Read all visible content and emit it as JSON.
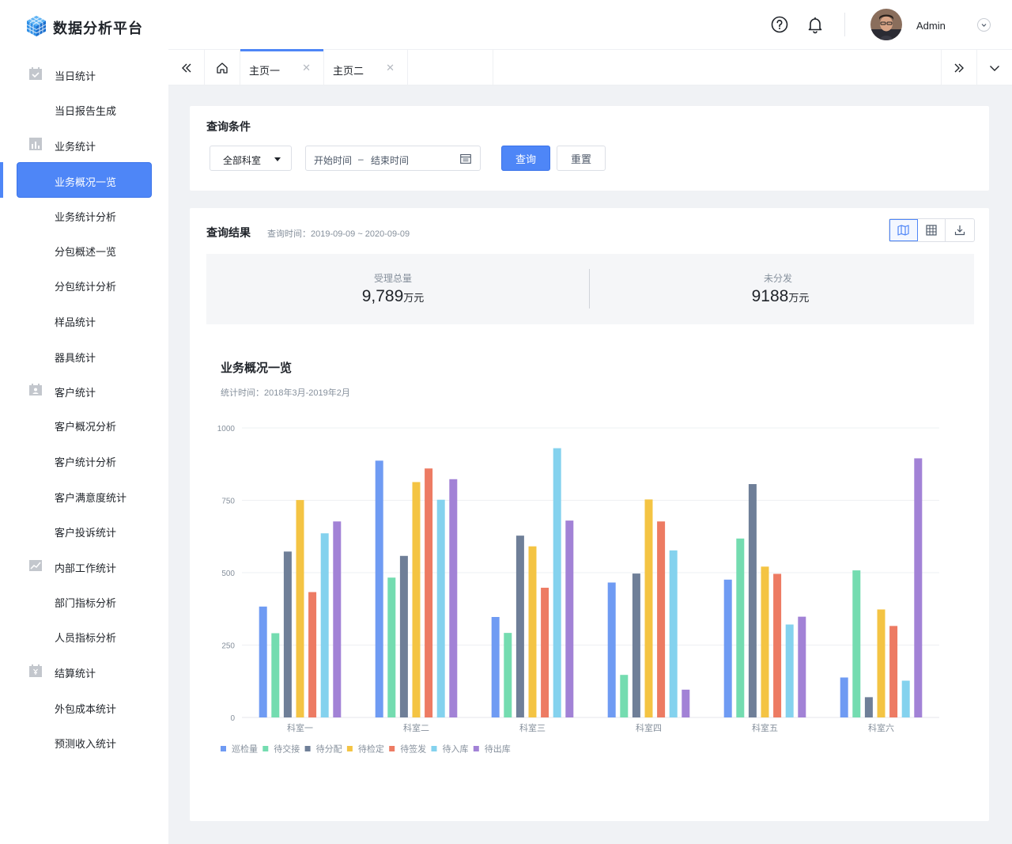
{
  "app": {
    "title": "数据分析平台"
  },
  "header": {
    "user_name": "Admin",
    "icons": [
      "help-icon",
      "bell-icon"
    ]
  },
  "sidebar": {
    "items": [
      {
        "label": "当日统计",
        "icon": "calendar-check-icon",
        "group": true
      },
      {
        "label": "当日报告生成"
      },
      {
        "label": "业务统计",
        "icon": "bar-chart-icon",
        "group": true
      },
      {
        "label": "业务概况一览",
        "active": true
      },
      {
        "label": "业务统计分析"
      },
      {
        "label": "分包概述一览"
      },
      {
        "label": "分包统计分析"
      },
      {
        "label": "样品统计"
      },
      {
        "label": "器具统计"
      },
      {
        "label": "客户统计",
        "icon": "contact-card-icon",
        "group": true
      },
      {
        "label": "客户概况分析"
      },
      {
        "label": "客户统计分析"
      },
      {
        "label": "客户满意度统计"
      },
      {
        "label": "客户投诉统计"
      },
      {
        "label": "内部工作统计",
        "icon": "trend-line-icon",
        "group": true
      },
      {
        "label": "部门指标分析"
      },
      {
        "label": "人员指标分析"
      },
      {
        "label": "结算统计",
        "icon": "yen-calendar-icon",
        "group": true
      },
      {
        "label": "外包成本统计"
      },
      {
        "label": "预测收入统计"
      }
    ]
  },
  "tabs": [
    {
      "label": "主页一",
      "active": true
    },
    {
      "label": "主页二",
      "active": false
    }
  ],
  "query": {
    "title": "查询条件",
    "department_value": "全部科室",
    "start_placeholder": "开始时间",
    "date_separator": "–",
    "end_placeholder": "结束时间",
    "search_label": "查询",
    "reset_label": "重置"
  },
  "result": {
    "title": "查询结果",
    "query_time": "查询时间：2019-09-09 ~ 2020-09-09",
    "summary": [
      {
        "label": "受理总量",
        "value": "9,789",
        "unit": "万元"
      },
      {
        "label": "未分发",
        "value": "9188",
        "unit": "万元"
      }
    ]
  },
  "chart_title": "业务概况一览",
  "chart_subtitle": "统计时间：2018年3月-2019年2月",
  "chart_data": {
    "type": "bar",
    "categories": [
      "科室一",
      "科室二",
      "科室三",
      "科室四",
      "科室五",
      "科室六"
    ],
    "ylim": [
      0,
      1000
    ],
    "yticks": [
      0,
      250,
      500,
      750,
      1000
    ],
    "grid": true,
    "legend_position": "bottom-left",
    "series": [
      {
        "name": "巡检量",
        "color": "#6f9bf3",
        "values": [
          383,
          887,
          347,
          466,
          476,
          138
        ]
      },
      {
        "name": "待交接",
        "color": "#74dcb0",
        "values": [
          291,
          483,
          292,
          147,
          618,
          508
        ]
      },
      {
        "name": "待分配",
        "color": "#6f7f98",
        "values": [
          573,
          558,
          628,
          497,
          806,
          70
        ]
      },
      {
        "name": "待检定",
        "color": "#f4c443",
        "values": [
          751,
          813,
          591,
          753,
          521,
          373
        ]
      },
      {
        "name": "待签发",
        "color": "#ed7b63",
        "values": [
          433,
          860,
          448,
          677,
          496,
          316
        ]
      },
      {
        "name": "待入库",
        "color": "#84d2ee",
        "values": [
          636,
          752,
          930,
          577,
          321,
          127
        ]
      },
      {
        "name": "待出库",
        "color": "#a282d6",
        "values": [
          677,
          823,
          680,
          96,
          348,
          895
        ]
      }
    ]
  }
}
